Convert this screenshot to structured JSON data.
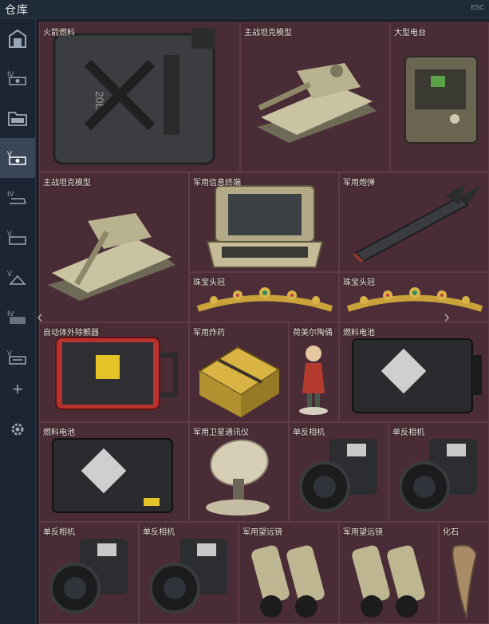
{
  "window": {
    "title": "仓库",
    "corner_text": "ESC"
  },
  "sidebar": {
    "items": [
      {
        "icon": "garage-icon"
      },
      {
        "icon": "vehicle-iv-icon"
      },
      {
        "icon": "folder-icon"
      },
      {
        "icon": "vehicle-v-icon",
        "active": true
      },
      {
        "icon": "vehicle-iv-icon"
      },
      {
        "icon": "vehicle-v-icon"
      },
      {
        "icon": "vehicle-v-icon"
      },
      {
        "icon": "vehicle-iv-icon"
      },
      {
        "icon": "vehicle-v-icon"
      },
      {
        "icon": "add-icon"
      },
      {
        "icon": "gear-icon"
      }
    ]
  },
  "items": [
    {
      "label": "火箭燃料"
    },
    {
      "label": "主战坦克模型"
    },
    {
      "label": "大型电台"
    },
    {
      "label": "主战坦克模型"
    },
    {
      "label": "军用信息终端"
    },
    {
      "label": "军用炮弹"
    },
    {
      "label": "珠宝头冠"
    },
    {
      "label": "珠宝头冠"
    },
    {
      "label": "自动体外除颤器"
    },
    {
      "label": "军用炸药"
    },
    {
      "label": "荷美尔陶俑"
    },
    {
      "label": "燃料电池"
    },
    {
      "label": "燃料电池"
    },
    {
      "label": "军用卫星通讯仪"
    },
    {
      "label": "单反相机"
    },
    {
      "label": "单反相机"
    },
    {
      "label": "单反相机"
    },
    {
      "label": "单反相机"
    },
    {
      "label": "军用望远镜"
    },
    {
      "label": "军用望远镜"
    },
    {
      "label": "化石"
    }
  ],
  "nav": {
    "prev": "‹",
    "next": "›",
    "add": "+"
  }
}
